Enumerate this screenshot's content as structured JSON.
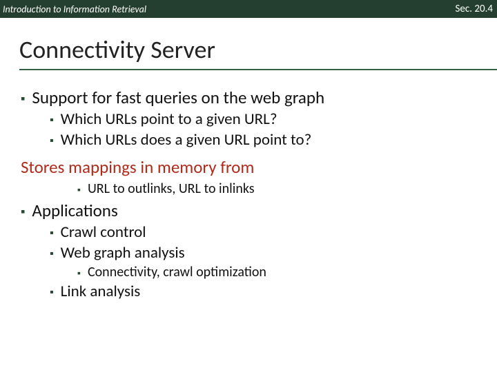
{
  "header": {
    "left": "Introduction to Information Retrieval",
    "right": "Sec. 20.4"
  },
  "title": "Connectivity Server",
  "items": {
    "support": "Support for fast queries on the web graph",
    "support_sub1": "Which URLs point to a given URL?",
    "support_sub2": "Which URLs does a given URL point to?",
    "stores": "Stores mappings in memory from",
    "stores_sub": "URL to outlinks, URL to inlinks",
    "apps": "Applications",
    "apps_sub1": "Crawl control",
    "apps_sub2": "Web graph analysis",
    "apps_sub2_sub": "Connectivity, crawl optimization",
    "apps_sub3": "Link analysis"
  }
}
